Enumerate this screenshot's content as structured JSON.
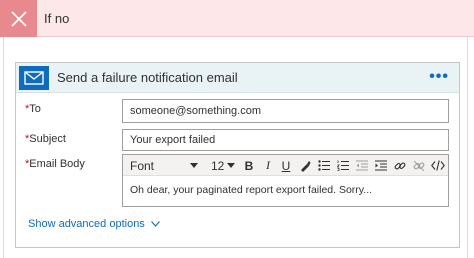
{
  "banner": {
    "title": "If no",
    "icon": "close-icon"
  },
  "action": {
    "title": "Send a failure notification email",
    "more_label": "•••",
    "icon": "mail-icon"
  },
  "fields": {
    "required_mark": "*",
    "to": {
      "label": "To",
      "value": "someone@something.com"
    },
    "subject": {
      "label": "Subject",
      "value": "Your export failed"
    },
    "body": {
      "label": "Email Body",
      "value": "Oh dear, your paginated report export failed. Sorry..."
    }
  },
  "toolbar": {
    "font": "Font",
    "size": "12",
    "bold": "B",
    "italic": "I",
    "underline": "U"
  },
  "advanced": {
    "label": "Show advanced options"
  },
  "colors": {
    "accent": "#0f6cbd",
    "banner_bg": "#fde7e9",
    "banner_icon_bg": "#e8898f",
    "header_bg": "#e9f2f5"
  }
}
